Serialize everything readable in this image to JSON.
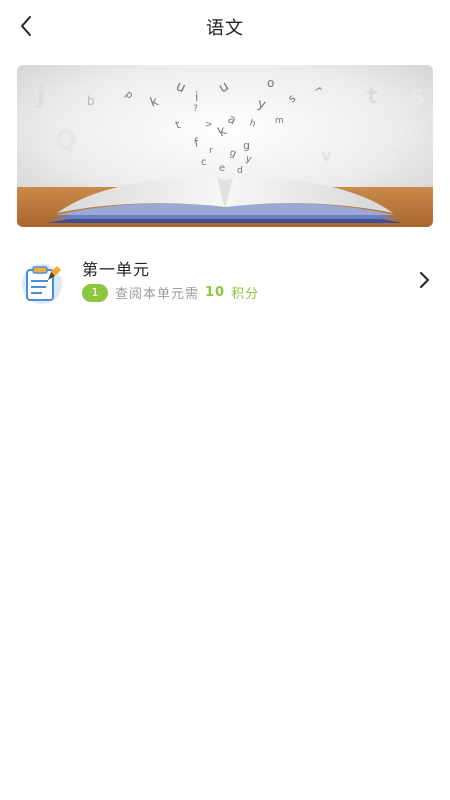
{
  "header": {
    "title": "语文"
  },
  "units": [
    {
      "title": "第一单元",
      "badge": "1",
      "cost_prefix": "查阅本单元需",
      "points": "10",
      "points_unit": "积分"
    }
  ],
  "colors": {
    "accent_green": "#8cc63f",
    "text_dark": "#222222",
    "text_gray": "#9a9a9a"
  },
  "icons": {
    "back": "chevron-left-icon",
    "unit": "notepad-pencil-icon",
    "forward": "chevron-right-icon"
  }
}
